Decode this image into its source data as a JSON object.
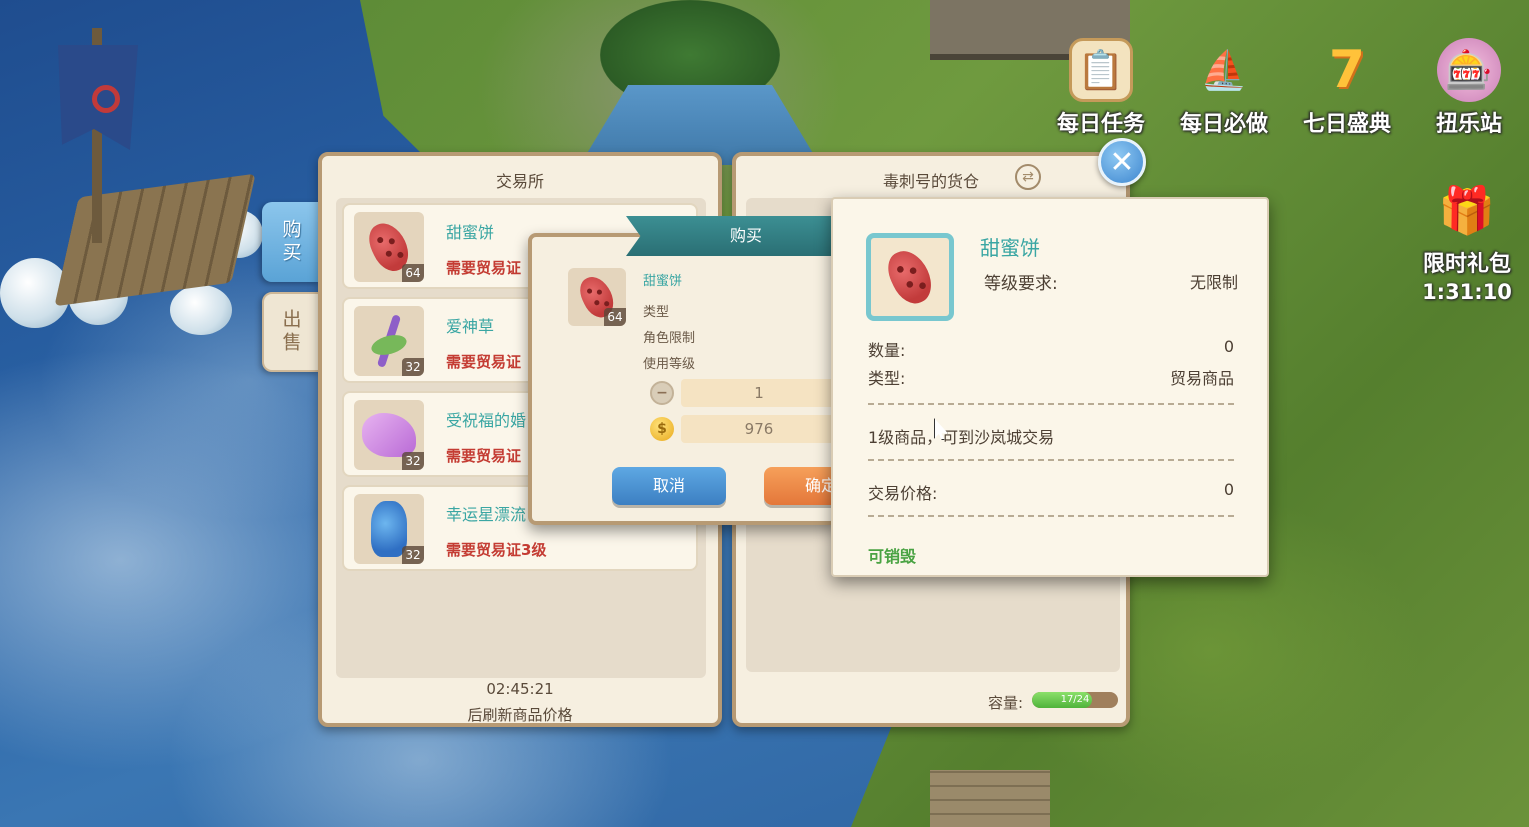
{
  "events": [
    {
      "label": "每日任务",
      "icon": "task-board-icon"
    },
    {
      "label": "每日必做",
      "icon": "ship-icon"
    },
    {
      "label": "七日盛典",
      "icon": "seven-day-icon"
    },
    {
      "label": "扭乐站",
      "icon": "gacha-icon"
    }
  ],
  "limited_gift": {
    "label": "限时礼包",
    "timer": "1:31:10"
  },
  "exchange": {
    "title": "交易所",
    "tab_buy": "购买",
    "tab_sell": "出售",
    "items": [
      {
        "name": "甜蜜饼",
        "count": "64",
        "requirement": "需要贸易证",
        "icon": "sweet-cookie-icon"
      },
      {
        "name": "爱神草",
        "count": "32",
        "requirement": "需要贸易证",
        "icon": "cupid-herb-icon"
      },
      {
        "name": "受祝福的婚",
        "count": "32",
        "requirement": "需要贸易证",
        "icon": "blessed-cloth-icon"
      },
      {
        "name": "幸运星漂流",
        "count": "32",
        "requirement": "需要贸易证3级",
        "icon": "lucky-vase-icon"
      }
    ],
    "countdown": "02:45:21",
    "refresh_text": "后刷新商品价格"
  },
  "cargo": {
    "title": "毒刺号的货仓",
    "capacity_label": "容量:",
    "capacity_text": "17/24",
    "capacity_fraction": 0.7
  },
  "buy_dialog": {
    "title": "购买",
    "item_name": "甜蜜饼",
    "item_count": "64",
    "field_type": "类型",
    "field_role": "角色限制",
    "field_level": "使用等级",
    "quantity": "1",
    "total_price": "976",
    "cancel": "取消",
    "confirm": "确定"
  },
  "tooltip": {
    "name": "甜蜜饼",
    "level_label": "等级要求:",
    "level_value": "无限制",
    "qty_label": "数量:",
    "qty_value": "0",
    "type_label": "类型:",
    "type_value": "贸易商品",
    "description": "1级商品，可到沙岚城交易",
    "price_label": "交易价格:",
    "price_value": "0",
    "destroy": "可销毁"
  },
  "colors": {
    "teal": "#3aa6a3",
    "red_req": "#c43c33",
    "panel_bg": "#f6efe0",
    "panel_border": "#b79a74",
    "green": "#4aa343"
  }
}
